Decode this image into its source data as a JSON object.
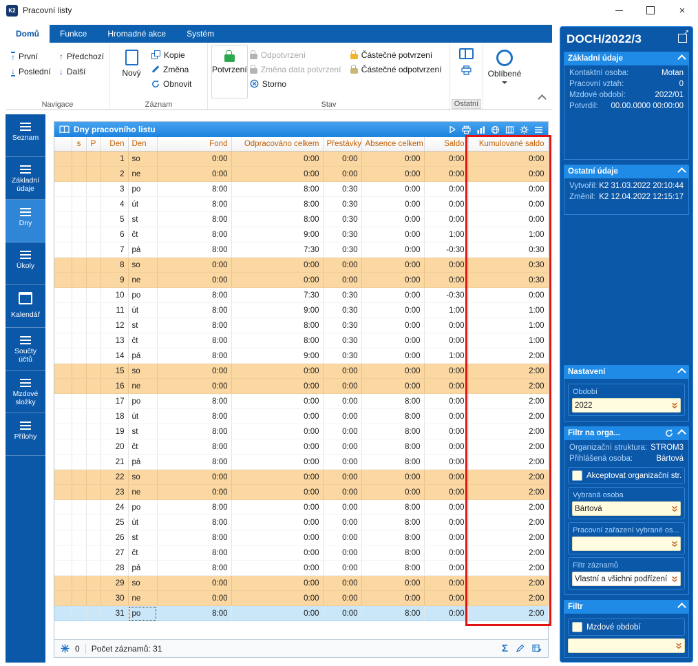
{
  "window": {
    "logo": "K2",
    "title": "Pracovní listy"
  },
  "ribbon": {
    "tabs": [
      "Domů",
      "Funkce",
      "Hromadné akce",
      "Systém"
    ],
    "navigace": {
      "label": "Navigace",
      "prvni": "První",
      "posledni": "Poslední",
      "predchozi": "Předchozí",
      "dalsi": "Další"
    },
    "zaznam": {
      "label": "Záznam",
      "novy": "Nový",
      "kopie": "Kopie",
      "zmena": "Změna",
      "obnovit": "Obnovit"
    },
    "stav": {
      "label": "Stav",
      "potvrzeni": "Potvrzení",
      "odpotvrzeni": "Odpotvrzení",
      "zmena_data": "Změna data potvrzení",
      "storno": "Storno",
      "castecne_potvrzeni": "Částečné potvrzení",
      "castecne_odpotvrzeni": "Částečné odpotvrzení"
    },
    "ostatni_label": "Ostatní",
    "oblibene_label": "Oblíbené"
  },
  "sidebar": {
    "items": [
      {
        "label": "Seznam"
      },
      {
        "label": "Základní údaje"
      },
      {
        "label": "Dny",
        "active": true
      },
      {
        "label": "Úkoly"
      },
      {
        "label": "Kalendář",
        "icon": "calendar"
      },
      {
        "label": "Součty účtů"
      },
      {
        "label": "Mzdové složky"
      },
      {
        "label": "Přílohy"
      }
    ]
  },
  "grid": {
    "title": "Dny pracovního listu",
    "columns": [
      "",
      "s",
      "P",
      "Den",
      "Den",
      "Fond",
      "Odpracováno celkem",
      "Přestávky",
      "Absence celkem",
      "Saldo",
      "Kumulované saldo"
    ],
    "selected_day": 31,
    "rows": [
      [
        1,
        "so",
        "0:00",
        "0:00",
        "0:00",
        "0:00",
        "0:00",
        "0:00"
      ],
      [
        2,
        "ne",
        "0:00",
        "0:00",
        "0:00",
        "0:00",
        "0:00",
        "0:00"
      ],
      [
        3,
        "po",
        "8:00",
        "8:00",
        "0:30",
        "0:00",
        "0:00",
        "0:00"
      ],
      [
        4,
        "út",
        "8:00",
        "8:00",
        "0:30",
        "0:00",
        "0:00",
        "0:00"
      ],
      [
        5,
        "st",
        "8:00",
        "8:00",
        "0:30",
        "0:00",
        "0:00",
        "0:00"
      ],
      [
        6,
        "čt",
        "8:00",
        "9:00",
        "0:30",
        "0:00",
        "1:00",
        "1:00"
      ],
      [
        7,
        "pá",
        "8:00",
        "7:30",
        "0:30",
        "0:00",
        "-0:30",
        "0:30"
      ],
      [
        8,
        "so",
        "0:00",
        "0:00",
        "0:00",
        "0:00",
        "0:00",
        "0:30"
      ],
      [
        9,
        "ne",
        "0:00",
        "0:00",
        "0:00",
        "0:00",
        "0:00",
        "0:30"
      ],
      [
        10,
        "po",
        "8:00",
        "7:30",
        "0:30",
        "0:00",
        "-0:30",
        "0:00"
      ],
      [
        11,
        "út",
        "8:00",
        "9:00",
        "0:30",
        "0:00",
        "1:00",
        "1:00"
      ],
      [
        12,
        "st",
        "8:00",
        "8:00",
        "0:30",
        "0:00",
        "0:00",
        "1:00"
      ],
      [
        13,
        "čt",
        "8:00",
        "8:00",
        "0:30",
        "0:00",
        "0:00",
        "1:00"
      ],
      [
        14,
        "pá",
        "8:00",
        "9:00",
        "0:30",
        "0:00",
        "1:00",
        "2:00"
      ],
      [
        15,
        "so",
        "0:00",
        "0:00",
        "0:00",
        "0:00",
        "0:00",
        "2:00"
      ],
      [
        16,
        "ne",
        "0:00",
        "0:00",
        "0:00",
        "0:00",
        "0:00",
        "2:00"
      ],
      [
        17,
        "po",
        "8:00",
        "0:00",
        "0:00",
        "8:00",
        "0:00",
        "2:00"
      ],
      [
        18,
        "út",
        "8:00",
        "0:00",
        "0:00",
        "8:00",
        "0:00",
        "2:00"
      ],
      [
        19,
        "st",
        "8:00",
        "0:00",
        "0:00",
        "8:00",
        "0:00",
        "2:00"
      ],
      [
        20,
        "čt",
        "8:00",
        "0:00",
        "0:00",
        "8:00",
        "0:00",
        "2:00"
      ],
      [
        21,
        "pá",
        "8:00",
        "0:00",
        "0:00",
        "8:00",
        "0:00",
        "2:00"
      ],
      [
        22,
        "so",
        "0:00",
        "0:00",
        "0:00",
        "0:00",
        "0:00",
        "2:00"
      ],
      [
        23,
        "ne",
        "0:00",
        "0:00",
        "0:00",
        "0:00",
        "0:00",
        "2:00"
      ],
      [
        24,
        "po",
        "8:00",
        "0:00",
        "0:00",
        "8:00",
        "0:00",
        "2:00"
      ],
      [
        25,
        "út",
        "8:00",
        "0:00",
        "0:00",
        "8:00",
        "0:00",
        "2:00"
      ],
      [
        26,
        "st",
        "8:00",
        "0:00",
        "0:00",
        "8:00",
        "0:00",
        "2:00"
      ],
      [
        27,
        "čt",
        "8:00",
        "0:00",
        "0:00",
        "8:00",
        "0:00",
        "2:00"
      ],
      [
        28,
        "pá",
        "8:00",
        "0:00",
        "0:00",
        "8:00",
        "0:00",
        "2:00"
      ],
      [
        29,
        "so",
        "0:00",
        "0:00",
        "0:00",
        "0:00",
        "0:00",
        "2:00"
      ],
      [
        30,
        "ne",
        "0:00",
        "0:00",
        "0:00",
        "0:00",
        "0:00",
        "2:00"
      ],
      [
        31,
        "po",
        "8:00",
        "0:00",
        "0:00",
        "8:00",
        "0:00",
        "2:00"
      ]
    ],
    "status": {
      "flag_count": "0",
      "record_count_label": "Počet záznamů: 31"
    }
  },
  "panel": {
    "title": "DOCH/2022/3",
    "zakladni": {
      "title": "Základní údaje",
      "fields": [
        {
          "label": "Kontaktní osoba:",
          "value": "Motan"
        },
        {
          "label": "Pracovní vztah:",
          "value": "0"
        },
        {
          "label": "Mzdové období:",
          "value": "2022/01"
        },
        {
          "label": "Potvrdil:",
          "value": "00.00.0000 00:00:00"
        }
      ]
    },
    "ostatni": {
      "title": "Ostatní údaje",
      "fields": [
        {
          "label": "Vytvořil:",
          "value": "K2 31.03.2022 20:10:44"
        },
        {
          "label": "Změnil:",
          "value": "K2 12.04.2022 12:15:17"
        }
      ]
    },
    "nastaveni": {
      "title": "Nastavení",
      "obdobi_label": "Období",
      "obdobi_value": "2022"
    },
    "filtr_orga": {
      "title": "Filtr na orga...",
      "fields": [
        {
          "label": "Organizační struktura:",
          "value": "STROM3"
        },
        {
          "label": "Přihlášená osoba:",
          "value": "Bártová"
        }
      ],
      "akceptovat_label": "Akceptovat organizační str...",
      "vybrana_osoba_label": "Vybraná osoba",
      "vybrana_osoba_value": "Bártová",
      "zarazeni_label": "Pracovní zařazení vybrané os...",
      "zarazeni_value": "",
      "filtr_zaznamu_label": "Filtr záznamů",
      "filtr_zaznamu_value": "Vlastní a všichni podřízení"
    },
    "filtr": {
      "title": "Filtr",
      "mzdove_label": "Mzdové období",
      "value": ""
    }
  }
}
